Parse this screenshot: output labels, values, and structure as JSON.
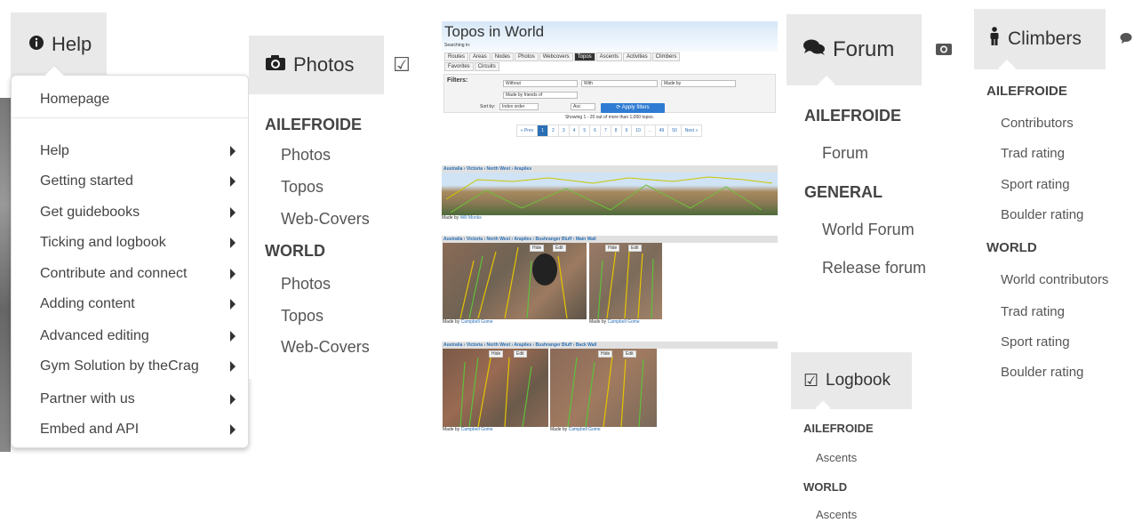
{
  "help": {
    "tab_label": "Help",
    "items": [
      {
        "label": "Homepage",
        "has_submenu": false
      },
      {
        "label": "Help",
        "has_submenu": true
      },
      {
        "label": "Getting started",
        "has_submenu": true
      },
      {
        "label": "Get guidebooks",
        "has_submenu": true
      },
      {
        "label": "Ticking and logbook",
        "has_submenu": true
      },
      {
        "label": "Contribute and connect",
        "has_submenu": true
      },
      {
        "label": "Adding content",
        "has_submenu": true
      },
      {
        "label": "Advanced editing",
        "has_submenu": true
      },
      {
        "label": "Gym Solution by theCrag",
        "has_submenu": true
      },
      {
        "label": "Partner with us",
        "has_submenu": true
      },
      {
        "label": "Embed and API",
        "has_submenu": true
      }
    ]
  },
  "photos": {
    "tab_label": "Photos",
    "sections": [
      {
        "heading": "AILEFROIDE",
        "links": [
          "Photos",
          "Topos",
          "Web-Covers"
        ]
      },
      {
        "heading": "WORLD",
        "links": [
          "Photos",
          "Topos",
          "Web-Covers"
        ]
      }
    ]
  },
  "topos": {
    "title": "Topos in World",
    "searching_in": "Searching in:",
    "tabs": [
      "Routes",
      "Areas",
      "Nodes",
      "Photos",
      "Webcovers",
      "Topos",
      "Ascents",
      "Activities",
      "Climbers",
      "Favorites",
      "Circuits"
    ],
    "active_tab": "Topos",
    "filters_label": "Filters:",
    "filter_without": "Without",
    "filter_with": "With",
    "filter_made_by": "Made by",
    "filter_friends": "Made by friends of",
    "sort_by_label": "Sort by:",
    "sort_value": "Index order",
    "sort_dir": "Asc",
    "apply_label": "Apply filters",
    "showing": "Showing 1 - 20 out of more than 1,000 topos.",
    "pager": [
      "« Prev",
      "1",
      "2",
      "3",
      "4",
      "5",
      "6",
      "7",
      "8",
      "9",
      "10",
      "..",
      "49",
      "50",
      "Next »"
    ],
    "current_page": "1",
    "results": [
      {
        "crumb": "Australia › Victoria › North West › Arapiles",
        "made_prefix": "Made by",
        "author": "Will Monks"
      },
      {
        "crumb": "Australia › Victoria › North West › Arapiles › Bushranger Bluff › Main Wall",
        "made_prefix": "Made by",
        "author": "Campbell Gome",
        "author2": "Campbell Gome"
      },
      {
        "crumb": "Australia › Victoria › North West › Arapiles › Bushranger Bluff › Back Wall",
        "made_prefix": "Made by",
        "author": "Campbell Gome",
        "author2": "Campbell Gome"
      }
    ],
    "hide_label": "Hide",
    "edit_label": "Edit"
  },
  "forum": {
    "tab_label": "Forum",
    "sections": [
      {
        "heading": "AILEFROIDE",
        "links": [
          "Forum"
        ]
      },
      {
        "heading": "GENERAL",
        "links": [
          "World Forum",
          "Release forum"
        ]
      }
    ]
  },
  "logbook": {
    "tab_label": "Logbook",
    "sections": [
      {
        "heading": "AILEFROIDE",
        "links": [
          "Ascents"
        ]
      },
      {
        "heading": "WORLD",
        "links": [
          "Ascents"
        ]
      }
    ]
  },
  "climbers": {
    "tab_label": "Climbers",
    "sections": [
      {
        "heading": "AILEFROIDE",
        "links": [
          "Contributors",
          "Trad rating",
          "Sport rating",
          "Boulder rating"
        ]
      },
      {
        "heading": "WORLD",
        "links": [
          "World contributors",
          "Trad rating",
          "Sport rating",
          "Boulder rating"
        ]
      }
    ]
  }
}
